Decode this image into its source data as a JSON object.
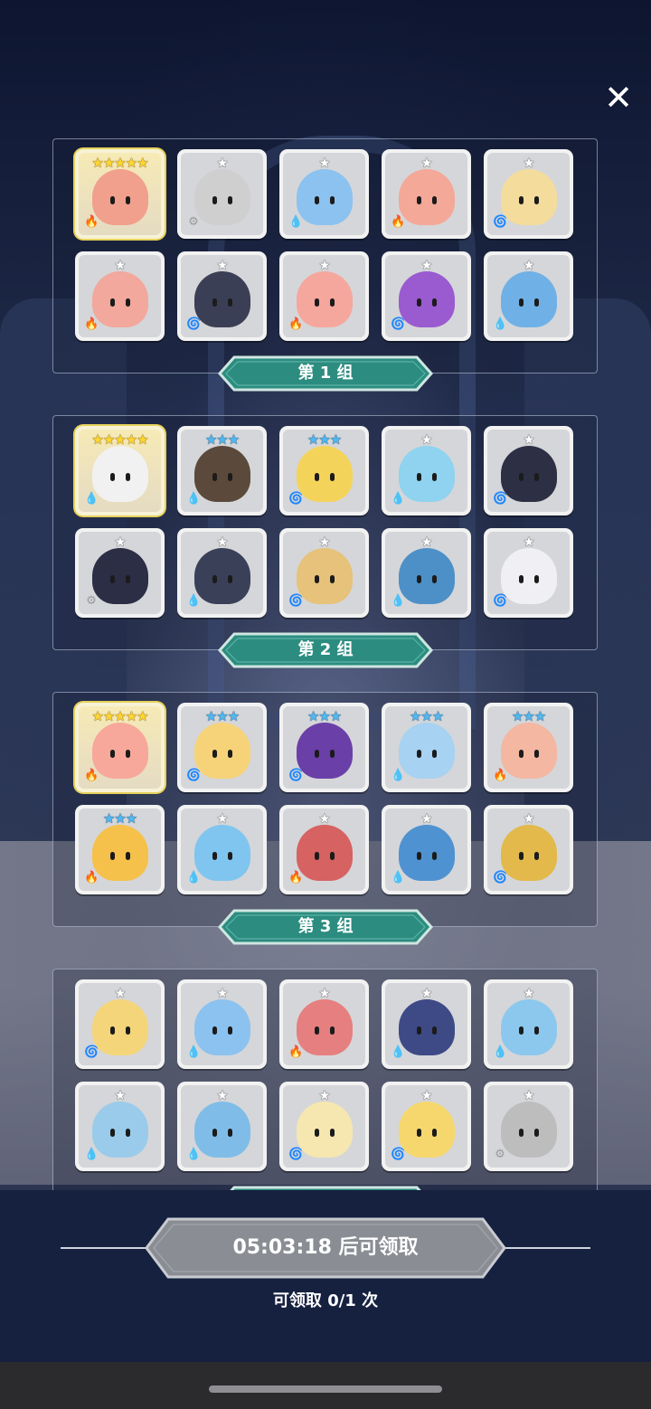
{
  "close_label": "✕",
  "groups": [
    {
      "label": "第 1 组",
      "heroes": [
        {
          "stars": "★★★★★",
          "star_color": "gold",
          "element": "fire",
          "elem_glyph": "🔥",
          "color": "#f0a08c",
          "gold": true
        },
        {
          "stars": "★",
          "star_color": "white",
          "element": "light",
          "elem_glyph": "⚙",
          "color": "#cfcfcf",
          "gold": false
        },
        {
          "stars": "★",
          "star_color": "white",
          "element": "water",
          "elem_glyph": "💧",
          "color": "#8cc2ef",
          "gold": false
        },
        {
          "stars": "★",
          "star_color": "white",
          "element": "fire",
          "elem_glyph": "🔥",
          "color": "#f4a898",
          "gold": false
        },
        {
          "stars": "★",
          "star_color": "white",
          "element": "wind",
          "elem_glyph": "🌀",
          "color": "#f4dc9c",
          "gold": false
        },
        {
          "stars": "★",
          "star_color": "white",
          "element": "fire",
          "elem_glyph": "🔥",
          "color": "#f2a89c",
          "gold": false
        },
        {
          "stars": "★",
          "star_color": "white",
          "element": "wind",
          "elem_glyph": "🌀",
          "color": "#3b3f55",
          "gold": false
        },
        {
          "stars": "★",
          "star_color": "white",
          "element": "fire",
          "elem_glyph": "🔥",
          "color": "#f5a79d",
          "gold": false
        },
        {
          "stars": "★",
          "star_color": "white",
          "element": "dark",
          "elem_glyph": "🌀",
          "color": "#9a5ad0",
          "gold": false
        },
        {
          "stars": "★",
          "star_color": "white",
          "element": "water",
          "elem_glyph": "💧",
          "color": "#6fb1e6",
          "gold": false
        }
      ]
    },
    {
      "label": "第 2 组",
      "heroes": [
        {
          "stars": "★★★★★",
          "star_color": "gold",
          "element": "water",
          "elem_glyph": "💧",
          "color": "#f1f1f1",
          "gold": true
        },
        {
          "stars": "★★★",
          "star_color": "blue",
          "element": "water",
          "elem_glyph": "💧",
          "color": "#5b4a3b",
          "gold": false
        },
        {
          "stars": "★★★",
          "star_color": "blue",
          "element": "wind",
          "elem_glyph": "🌀",
          "color": "#f4d35b",
          "gold": false
        },
        {
          "stars": "★",
          "star_color": "white",
          "element": "water",
          "elem_glyph": "💧",
          "color": "#8fd3f0",
          "gold": false
        },
        {
          "stars": "★",
          "star_color": "white",
          "element": "wind",
          "elem_glyph": "🌀",
          "color": "#2d2f44",
          "gold": false
        },
        {
          "stars": "★",
          "star_color": "white",
          "element": "light",
          "elem_glyph": "⚙",
          "color": "#2c2e45",
          "gold": false
        },
        {
          "stars": "★",
          "star_color": "white",
          "element": "water",
          "elem_glyph": "💧",
          "color": "#3a4058",
          "gold": false
        },
        {
          "stars": "★",
          "star_color": "white",
          "element": "wind",
          "elem_glyph": "🌀",
          "color": "#e6c27b",
          "gold": false
        },
        {
          "stars": "★",
          "star_color": "white",
          "element": "water",
          "elem_glyph": "💧",
          "color": "#4d90c8",
          "gold": false
        },
        {
          "stars": "★",
          "star_color": "white",
          "element": "wind",
          "elem_glyph": "🌀",
          "color": "#f0f0f4",
          "gold": false
        }
      ]
    },
    {
      "label": "第 3 组",
      "heroes": [
        {
          "stars": "★★★★★",
          "star_color": "gold",
          "element": "fire",
          "elem_glyph": "🔥",
          "color": "#f7a89a",
          "gold": true
        },
        {
          "stars": "★★★",
          "star_color": "blue",
          "element": "wind",
          "elem_glyph": "🌀",
          "color": "#f6d379",
          "gold": false
        },
        {
          "stars": "★★★",
          "star_color": "blue",
          "element": "dark",
          "elem_glyph": "🌀",
          "color": "#6b3fa8",
          "gold": false
        },
        {
          "stars": "★★★",
          "star_color": "blue",
          "element": "water",
          "elem_glyph": "💧",
          "color": "#a7d2f2",
          "gold": false
        },
        {
          "stars": "★★★",
          "star_color": "blue",
          "element": "fire",
          "elem_glyph": "🔥",
          "color": "#f3b7a2",
          "gold": false
        },
        {
          "stars": "★★★",
          "star_color": "blue",
          "element": "fire",
          "elem_glyph": "🔥",
          "color": "#f5c14a",
          "gold": false
        },
        {
          "stars": "★",
          "star_color": "white",
          "element": "water",
          "elem_glyph": "💧",
          "color": "#80c5ef",
          "gold": false
        },
        {
          "stars": "★",
          "star_color": "white",
          "element": "fire",
          "elem_glyph": "🔥",
          "color": "#d66262",
          "gold": false
        },
        {
          "stars": "★",
          "star_color": "white",
          "element": "water",
          "elem_glyph": "💧",
          "color": "#4f92d1",
          "gold": false
        },
        {
          "stars": "★",
          "star_color": "white",
          "element": "wind",
          "elem_glyph": "🌀",
          "color": "#e2b94a",
          "gold": false
        }
      ]
    },
    {
      "label": "",
      "heroes": [
        {
          "stars": "★",
          "star_color": "white",
          "element": "wind",
          "elem_glyph": "🌀",
          "color": "#f4d57a",
          "gold": false
        },
        {
          "stars": "★",
          "star_color": "white",
          "element": "water",
          "elem_glyph": "💧",
          "color": "#8cc2ef",
          "gold": false
        },
        {
          "stars": "★",
          "star_color": "white",
          "element": "fire",
          "elem_glyph": "🔥",
          "color": "#e67f7f",
          "gold": false
        },
        {
          "stars": "★",
          "star_color": "white",
          "element": "water",
          "elem_glyph": "💧",
          "color": "#3e4a86",
          "gold": false
        },
        {
          "stars": "★",
          "star_color": "white",
          "element": "water",
          "elem_glyph": "💧",
          "color": "#8cc8ee",
          "gold": false
        },
        {
          "stars": "★",
          "star_color": "white",
          "element": "water",
          "elem_glyph": "💧",
          "color": "#9acbea",
          "gold": false
        },
        {
          "stars": "★",
          "star_color": "white",
          "element": "water",
          "elem_glyph": "💧",
          "color": "#7fbde8",
          "gold": false
        },
        {
          "stars": "★",
          "star_color": "white",
          "element": "wind",
          "elem_glyph": "🌀",
          "color": "#f6e6b0",
          "gold": false
        },
        {
          "stars": "★",
          "star_color": "white",
          "element": "wind",
          "elem_glyph": "🌀",
          "color": "#f5d76e",
          "gold": false
        },
        {
          "stars": "★",
          "star_color": "white",
          "element": "light",
          "elem_glyph": "⚙",
          "color": "#bdbdbd",
          "gold": false
        }
      ]
    }
  ],
  "claim": {
    "countdown_label": "05:03:18 后可领取",
    "count_label": "可领取 0/1 次"
  },
  "colors": {
    "ribbon_fill": "#2c8c80",
    "ribbon_edge": "#cfe6e1",
    "claim_btn_fill": "#8a8d94",
    "claim_btn_edge": "#c9cbd1"
  }
}
